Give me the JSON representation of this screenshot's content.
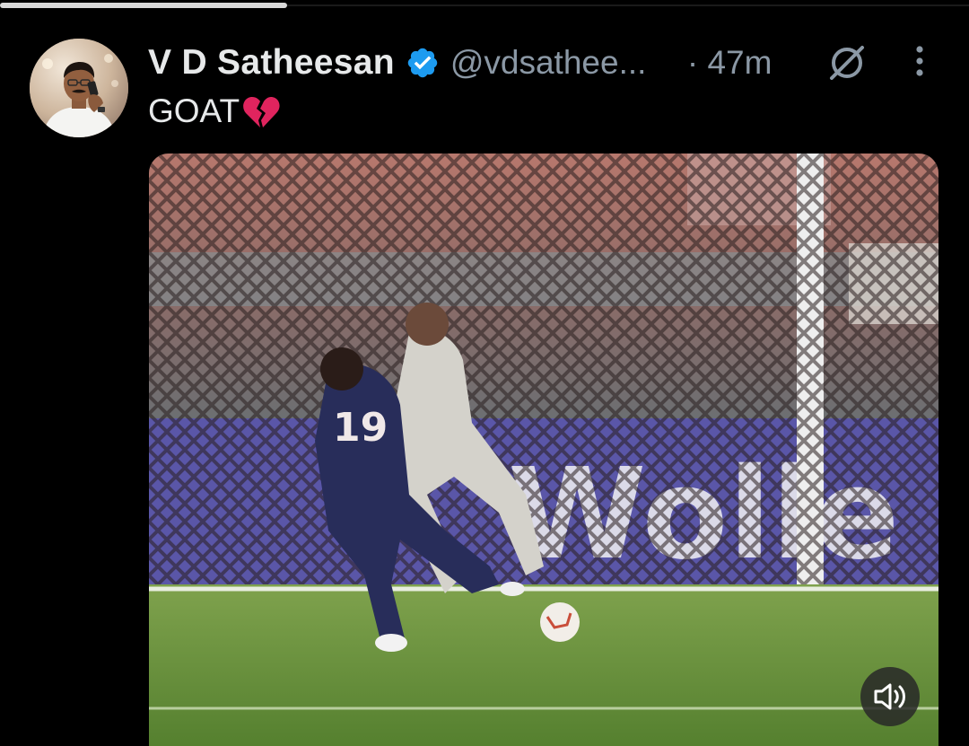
{
  "tweet": {
    "display_name": "V D Satheesan",
    "handle": "@vdsathee...",
    "time": "· 47m",
    "text": "GOAT",
    "emoji": "broken-heart",
    "verified": true
  },
  "icons": {
    "verified": "verified-badge-icon",
    "grok": "grok-icon",
    "more": "more-vertical-icon",
    "sound": "speaker-icon"
  },
  "colors": {
    "background": "#000000",
    "primary_text": "#e7e9ea",
    "secondary_text": "#8b98a5",
    "verified_blue": "#1d9bf0",
    "heart_red": "#e0245e"
  }
}
